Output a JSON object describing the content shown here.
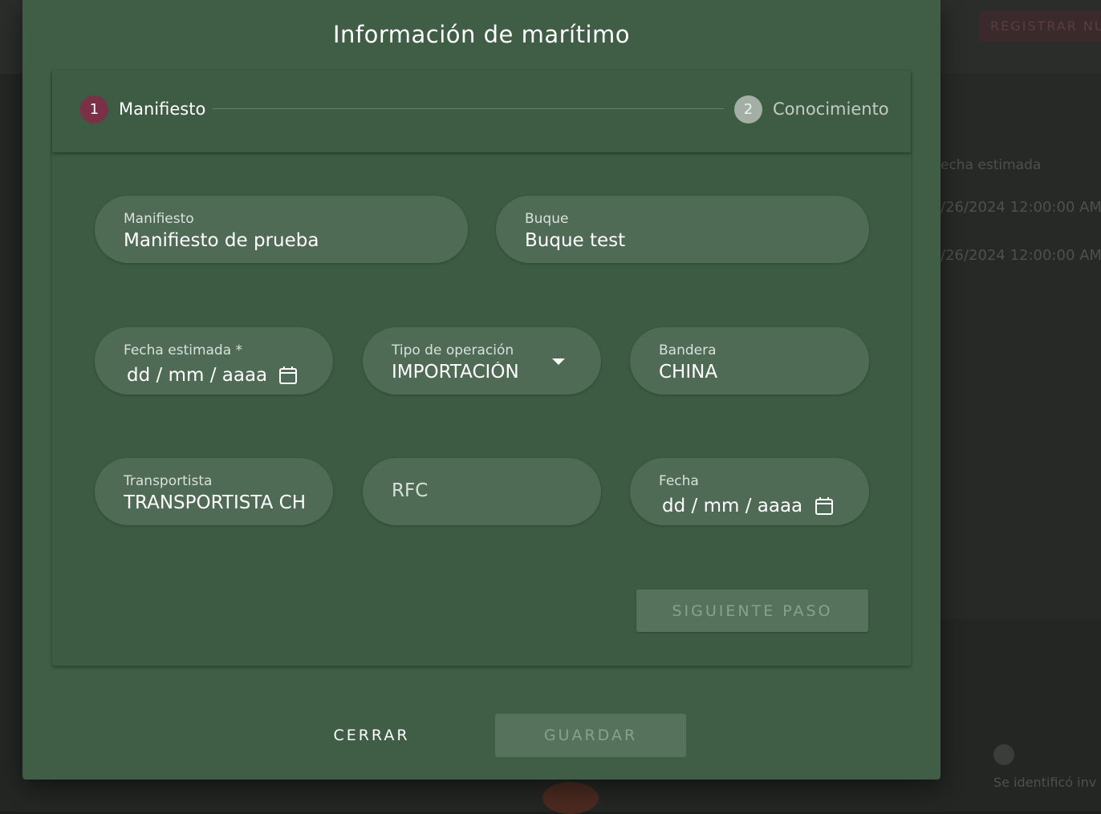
{
  "background": {
    "register_button": "REGISTRAR NU",
    "column_header": "echa estimada",
    "row_1_date": "/26/2024 12:00:00 AM",
    "row_2_date": "/26/2024 12:00:00 AM",
    "footer_text": "Se identificó inv"
  },
  "dialog": {
    "title": "Información de marítimo",
    "steps": [
      {
        "number": "1",
        "label": "Manifiesto",
        "state": "active"
      },
      {
        "number": "2",
        "label": "Conocimiento",
        "state": "inactive"
      }
    ],
    "fields": {
      "manifiesto": {
        "label": "Manifiesto",
        "value": "Manifiesto de prueba"
      },
      "buque": {
        "label": "Buque",
        "value": "Buque test"
      },
      "fecha_estimada": {
        "label": "Fecha estimada *",
        "value": "dd / mm / aaaa"
      },
      "tipo_operacion": {
        "label": "Tipo de operación",
        "value": "IMPORTACIÓN"
      },
      "bandera": {
        "label": "Bandera",
        "value": "CHINA"
      },
      "transportista": {
        "label": "Transportista",
        "value": "TRANSPORTISTA CHI"
      },
      "rfc": {
        "placeholder": "RFC"
      },
      "fecha": {
        "label": "Fecha",
        "value": "dd / mm / aaaa"
      }
    },
    "next_button": "SIGUIENTE PASO",
    "close_button": "CERRAR",
    "save_button": "GUARDAR"
  },
  "colors": {
    "dialog_bg": "#3f5e45",
    "field_bg": "#4f6a55",
    "step_active": "#7a3047",
    "step_inactive": "#a3aea5"
  }
}
